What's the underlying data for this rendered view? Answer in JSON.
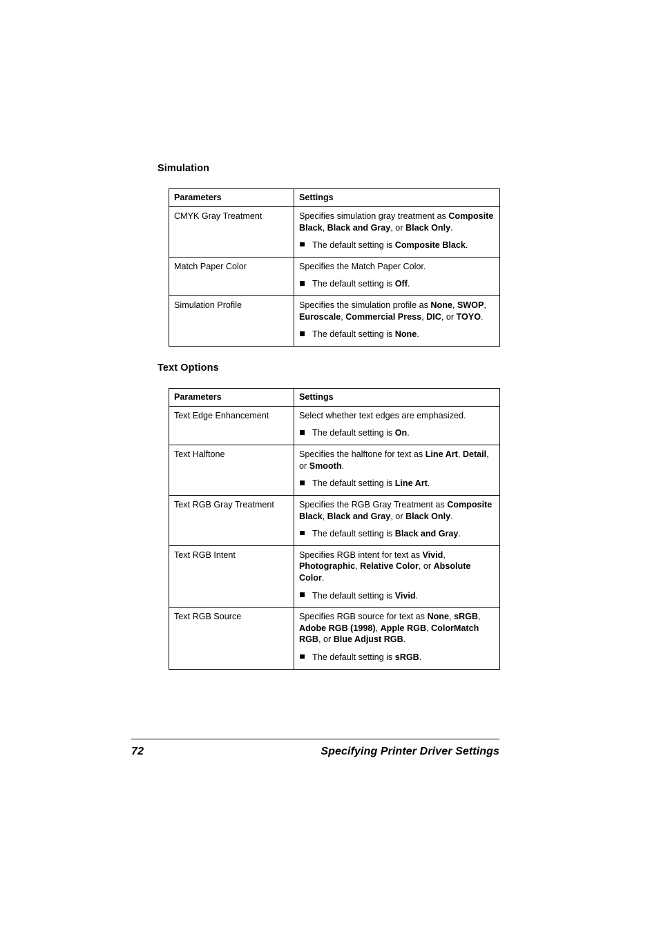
{
  "document": {
    "page_number": "72",
    "running_title": "Specifying Printer Driver Settings"
  },
  "sections": [
    {
      "heading": "Simulation",
      "table": {
        "columns": [
          "Parameters",
          "Settings"
        ],
        "rows": [
          {
            "parameter": "CMYK Gray Treatment",
            "description_parts": [
              {
                "t": "Specifies simulation gray treatment as ",
                "b": false
              },
              {
                "t": "Composite Black",
                "b": true
              },
              {
                "t": ", ",
                "b": false
              },
              {
                "t": "Black and Gray",
                "b": true
              },
              {
                "t": ", or ",
                "b": false
              },
              {
                "t": "Black Only",
                "b": true
              },
              {
                "t": ".",
                "b": false
              }
            ],
            "default_parts": [
              {
                "t": "The default setting is ",
                "b": false
              },
              {
                "t": "Composite Black",
                "b": true
              },
              {
                "t": ".",
                "b": false
              }
            ]
          },
          {
            "parameter": "Match Paper Color",
            "description_parts": [
              {
                "t": "Specifies the Match Paper Color.",
                "b": false
              }
            ],
            "default_parts": [
              {
                "t": "The default setting is ",
                "b": false
              },
              {
                "t": "Off",
                "b": true
              },
              {
                "t": ".",
                "b": false
              }
            ]
          },
          {
            "parameter": "Simulation Profile",
            "description_parts": [
              {
                "t": "Specifies the simulation profile as ",
                "b": false
              },
              {
                "t": "None",
                "b": true
              },
              {
                "t": ", ",
                "b": false
              },
              {
                "t": "SWOP",
                "b": true
              },
              {
                "t": ", ",
                "b": false
              },
              {
                "t": "Euroscale",
                "b": true
              },
              {
                "t": ", ",
                "b": false
              },
              {
                "t": "Commercial Press",
                "b": true
              },
              {
                "t": ", ",
                "b": false
              },
              {
                "t": "DIC",
                "b": true
              },
              {
                "t": ", or ",
                "b": false
              },
              {
                "t": "TOYO",
                "b": true
              },
              {
                "t": ".",
                "b": false
              }
            ],
            "default_parts": [
              {
                "t": "The default setting is ",
                "b": false
              },
              {
                "t": "None",
                "b": true
              },
              {
                "t": ".",
                "b": false
              }
            ]
          }
        ]
      }
    },
    {
      "heading": "Text Options",
      "table": {
        "columns": [
          "Parameters",
          "Settings"
        ],
        "rows": [
          {
            "parameter": "Text Edge Enhancement",
            "description_parts": [
              {
                "t": "Select whether text edges are emphasized.",
                "b": false
              }
            ],
            "default_parts": [
              {
                "t": "The default setting is ",
                "b": false
              },
              {
                "t": "On",
                "b": true
              },
              {
                "t": ".",
                "b": false
              }
            ]
          },
          {
            "parameter": "Text Halftone",
            "description_parts": [
              {
                "t": "Specifies the halftone for text as ",
                "b": false
              },
              {
                "t": "Line Art",
                "b": true
              },
              {
                "t": ", ",
                "b": false
              },
              {
                "t": "Detail",
                "b": true
              },
              {
                "t": ", or ",
                "b": false
              },
              {
                "t": "Smooth",
                "b": true
              },
              {
                "t": ".",
                "b": false
              }
            ],
            "default_parts": [
              {
                "t": "The default setting is ",
                "b": false
              },
              {
                "t": "Line Art",
                "b": true
              },
              {
                "t": ".",
                "b": false
              }
            ]
          },
          {
            "parameter": "Text RGB Gray Treatment",
            "description_parts": [
              {
                "t": "Specifies the RGB Gray Treatment as ",
                "b": false
              },
              {
                "t": "Composite Black",
                "b": true
              },
              {
                "t": ", ",
                "b": false
              },
              {
                "t": "Black and Gray",
                "b": true
              },
              {
                "t": ", or ",
                "b": false
              },
              {
                "t": "Black Only",
                "b": true
              },
              {
                "t": ".",
                "b": false
              }
            ],
            "default_parts": [
              {
                "t": "The default setting is ",
                "b": false
              },
              {
                "t": "Black and Gray",
                "b": true
              },
              {
                "t": ".",
                "b": false
              }
            ]
          },
          {
            "parameter": "Text RGB Intent",
            "description_parts": [
              {
                "t": "Specifies RGB intent for text as ",
                "b": false
              },
              {
                "t": "Vivid",
                "b": true
              },
              {
                "t": ", ",
                "b": false
              },
              {
                "t": "Photographic",
                "b": true
              },
              {
                "t": ", ",
                "b": false
              },
              {
                "t": "Relative Color",
                "b": true
              },
              {
                "t": ", or ",
                "b": false
              },
              {
                "t": "Absolute Color",
                "b": true
              },
              {
                "t": ".",
                "b": false
              }
            ],
            "default_parts": [
              {
                "t": "The default setting is ",
                "b": false
              },
              {
                "t": "Vivid",
                "b": true
              },
              {
                "t": ".",
                "b": false
              }
            ]
          },
          {
            "parameter": "Text RGB Source",
            "description_parts": [
              {
                "t": "Specifies RGB source for text as ",
                "b": false
              },
              {
                "t": "None",
                "b": true
              },
              {
                "t": ", ",
                "b": false
              },
              {
                "t": "sRGB",
                "b": true
              },
              {
                "t": ", ",
                "b": false
              },
              {
                "t": "Adobe RGB (1998)",
                "b": true
              },
              {
                "t": ", ",
                "b": false
              },
              {
                "t": "Apple RGB",
                "b": true
              },
              {
                "t": ", ",
                "b": false
              },
              {
                "t": "ColorMatch RGB",
                "b": true
              },
              {
                "t": ", or ",
                "b": false
              },
              {
                "t": "Blue Adjust RGB",
                "b": true
              },
              {
                "t": ".",
                "b": false
              }
            ],
            "default_parts": [
              {
                "t": "The default setting is ",
                "b": false
              },
              {
                "t": "sRGB",
                "b": true
              },
              {
                "t": ".",
                "b": false
              }
            ]
          }
        ]
      }
    }
  ],
  "icons": {
    "bullet": "filled-square-bullet"
  },
  "colors": {
    "text": "#000000",
    "rule": "#000000",
    "background": "#ffffff"
  }
}
